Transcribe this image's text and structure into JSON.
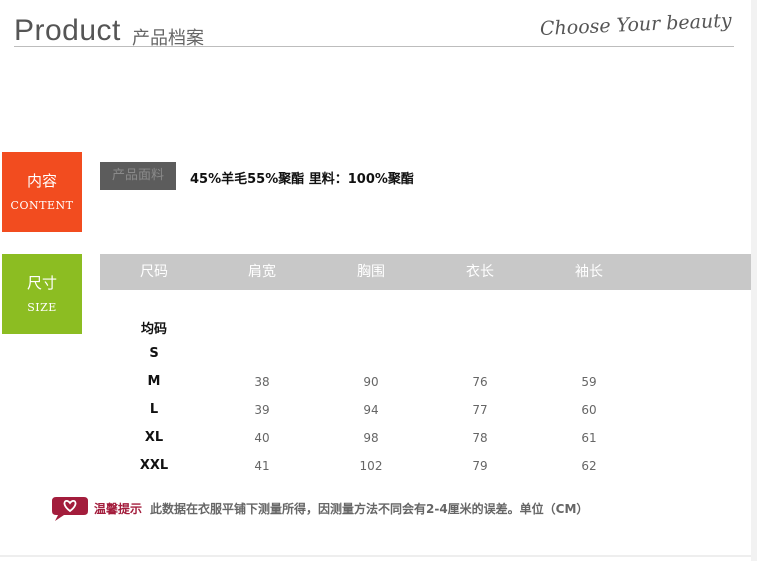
{
  "header": {
    "title": "Product",
    "subtitle": "产品档案",
    "slogan": "Choose Your beauty"
  },
  "tags": {
    "content": {
      "cn": "内容",
      "en": "CONTENT",
      "color": "#f24c1f"
    },
    "size": {
      "cn": "尺寸",
      "en": "SIZE",
      "color": "#8cbd22"
    }
  },
  "fabric": {
    "label": "产品面料",
    "value": "45%羊毛55%聚酯 里料：100%聚酯"
  },
  "size_table": {
    "headers": [
      "尺码",
      "肩宽",
      "胸围",
      "衣长",
      "袖长"
    ],
    "group_label": "均码",
    "rows": [
      {
        "size": "S",
        "shoulder": "",
        "chest": "",
        "length": "",
        "sleeve": ""
      },
      {
        "size": "M",
        "shoulder": "38",
        "chest": "90",
        "length": "76",
        "sleeve": "59"
      },
      {
        "size": "L",
        "shoulder": "39",
        "chest": "94",
        "length": "77",
        "sleeve": "60"
      },
      {
        "size": "XL",
        "shoulder": "40",
        "chest": "98",
        "length": "78",
        "sleeve": "61"
      },
      {
        "size": "XXL",
        "shoulder": "41",
        "chest": "102",
        "length": "79",
        "sleeve": "62"
      }
    ]
  },
  "tip": {
    "icon": "heart-speech-icon",
    "title": "温馨提示",
    "text": "此数据在衣服平铺下测量所得，因测量方法不同会有2-4厘米的误差。单位（CM）",
    "color": "#a31d3c"
  }
}
